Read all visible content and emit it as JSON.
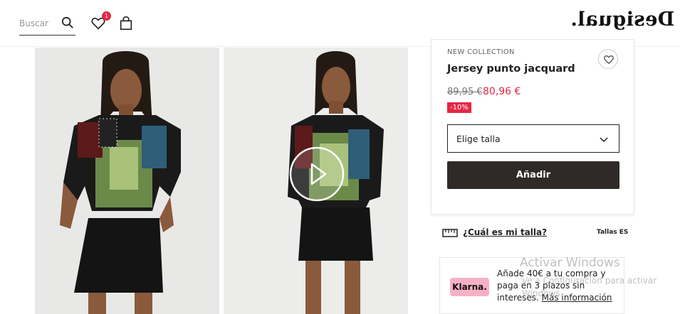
{
  "header": {
    "search_placeholder": "Buscar",
    "wishlist_count": "1",
    "logo_text": "Desigual."
  },
  "product": {
    "collection": "NEW COLLECTION",
    "name": "Jersey punto jacquard",
    "old_price": "89,95 €",
    "new_price": "80,96 €",
    "discount": "-10%",
    "size_select_label": "Elige talla",
    "add_button": "Añadir"
  },
  "size_guide": {
    "link": "¿Cuál es mi talla?",
    "region": "Tallas ES"
  },
  "klarna": {
    "logo": "Klarna.",
    "text": "Añade 40€ a tu compra y paga en 3 plazos sin intereses.",
    "link": "Más información"
  },
  "watermark": {
    "line1": "Activar Windows",
    "line2": "Ve a Configuración para activar Windows."
  },
  "colors": {
    "accent": "#e52745",
    "button_dark": "#2f2a27",
    "klarna_pink": "#f7b1c6"
  }
}
